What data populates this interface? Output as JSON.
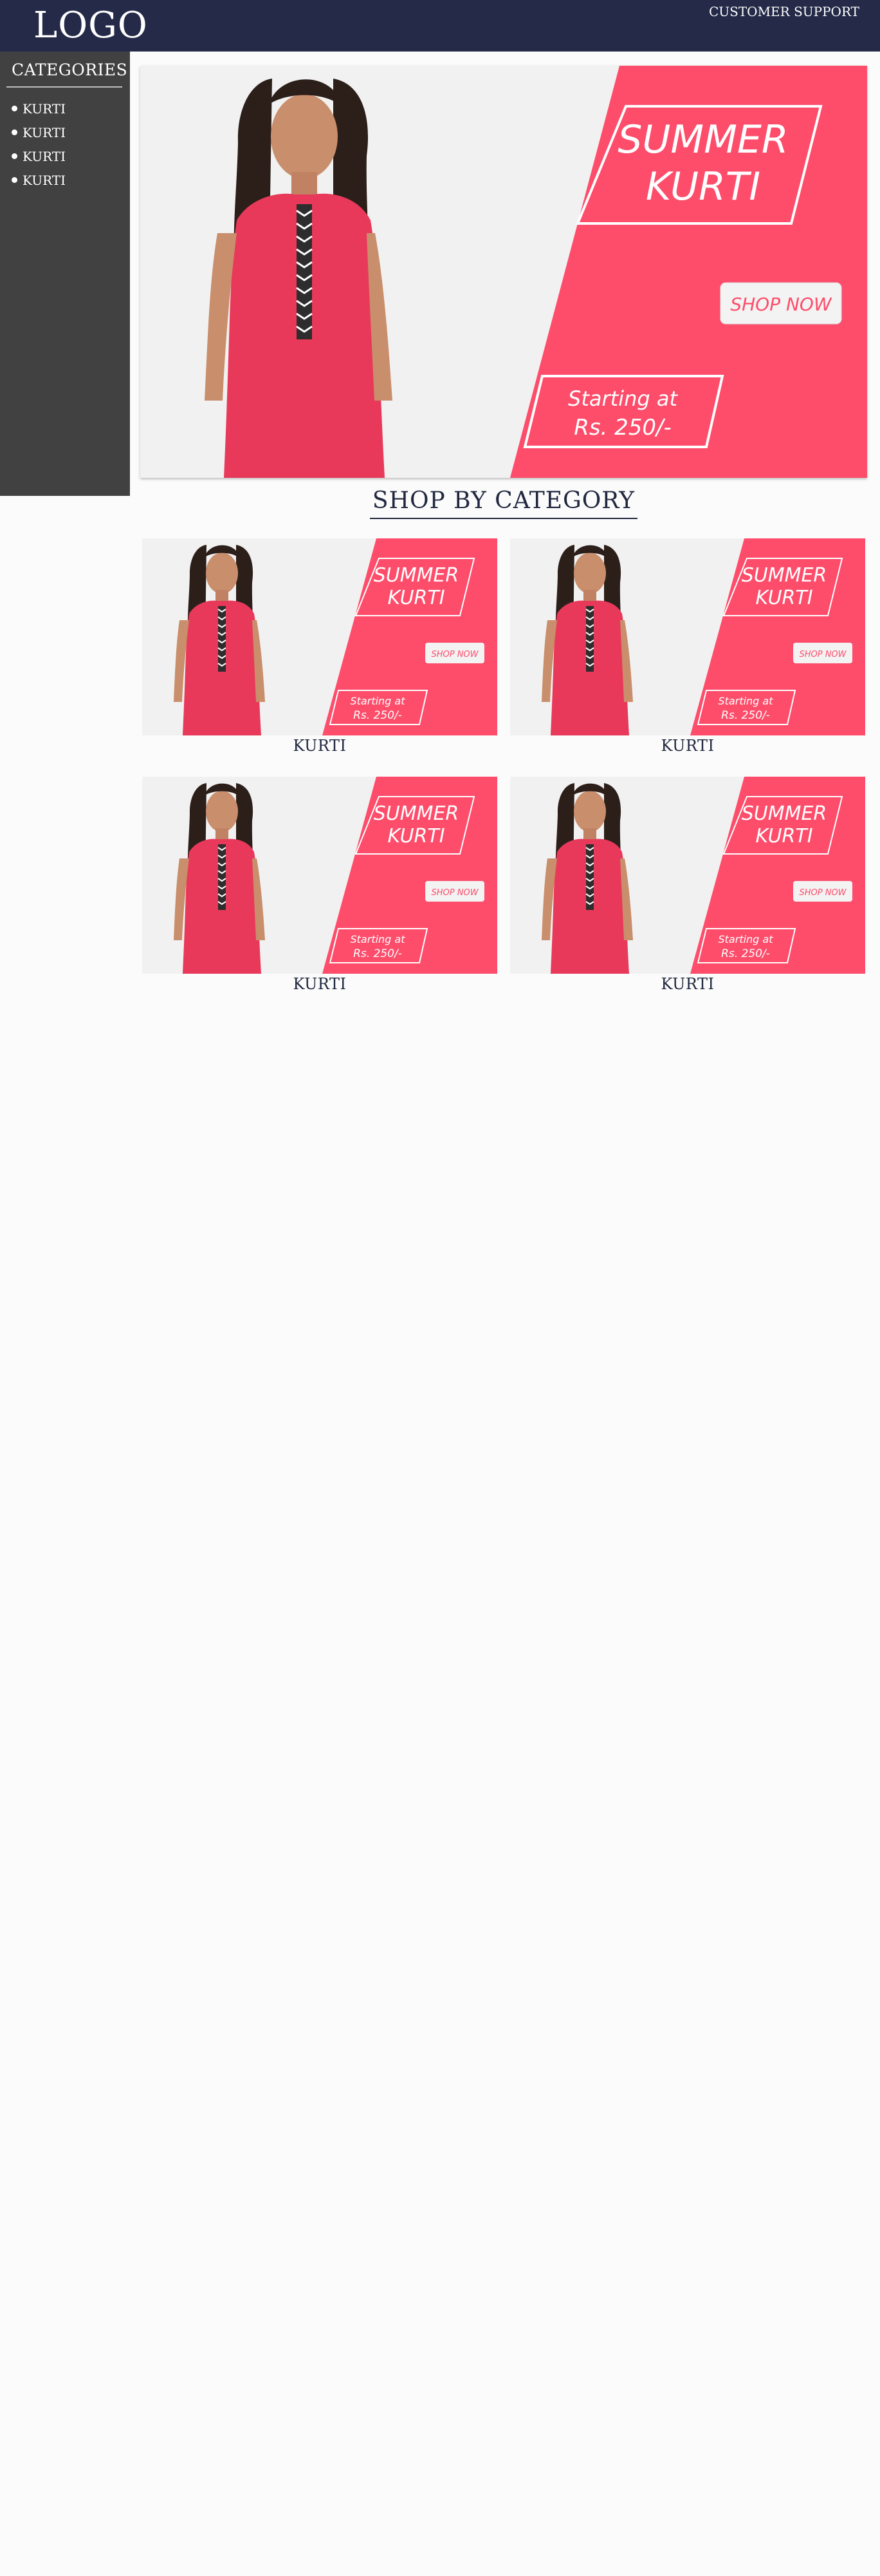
{
  "header": {
    "logo": "LOGO",
    "support_link": "CUSTOMER SUPPORT"
  },
  "sidebar": {
    "title": "CATEGORIES",
    "items": [
      {
        "label": "KURTI"
      },
      {
        "label": "KURTI"
      },
      {
        "label": "KURTI"
      },
      {
        "label": "KURTI"
      }
    ]
  },
  "hero": {
    "headline_line1": "SUMMER",
    "headline_line2": "KURTI",
    "cta": "SHOP NOW",
    "price_line1": "Starting at",
    "price_line2": "Rs. 250/-"
  },
  "section": {
    "title": "SHOP BY CATEGORY"
  },
  "cards": [
    {
      "label": "KURTI",
      "headline_line1": "SUMMER",
      "headline_line2": "KURTI",
      "cta": "SHOP NOW",
      "price_line1": "Starting at",
      "price_line2": "Rs. 250/-"
    },
    {
      "label": "KURTI",
      "headline_line1": "SUMMER",
      "headline_line2": "KURTI",
      "cta": "SHOP NOW",
      "price_line1": "Starting at",
      "price_line2": "Rs. 250/-"
    },
    {
      "label": "KURTI",
      "headline_line1": "SUMMER",
      "headline_line2": "KURTI",
      "cta": "SHOP NOW",
      "price_line1": "Starting at",
      "price_line2": "Rs. 250/-"
    },
    {
      "label": "KURTI",
      "headline_line1": "SUMMER",
      "headline_line2": "KURTI",
      "cta": "SHOP NOW",
      "price_line1": "Starting at",
      "price_line2": "Rs. 250/-"
    }
  ],
  "colors": {
    "header_bg": "#242a48",
    "sidebar_bg": "#414141",
    "banner_accent": "#fd4d6b",
    "dress": "#e8395a"
  }
}
